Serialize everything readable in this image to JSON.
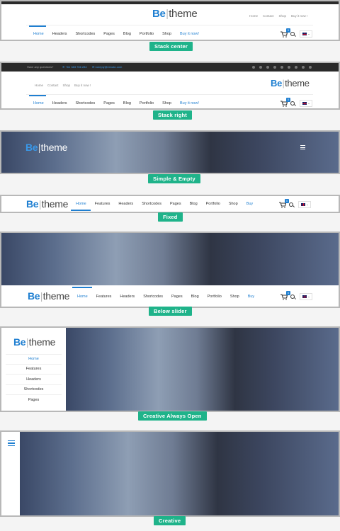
{
  "logo": {
    "be": "Be",
    "bar": "|",
    "theme": "theme"
  },
  "sections": [
    {
      "label": "Stack center"
    },
    {
      "label": "Stack right"
    },
    {
      "label": "Simple & Empty"
    },
    {
      "label": "Fixed"
    },
    {
      "label": "Below slider"
    },
    {
      "label": "Creative Always Open"
    },
    {
      "label": "Creative"
    }
  ],
  "top_links": [
    "Home",
    "Contact",
    "Shop",
    "Buy it now !"
  ],
  "main_menu": [
    "Home",
    "Headers",
    "Shortcodes",
    "Pages",
    "Blog",
    "Portfolio",
    "Shop",
    "Buy it now!"
  ],
  "wide_menu": [
    "Home",
    "Features",
    "Headers",
    "Shortcodes",
    "Pages",
    "Blog",
    "Portfolio",
    "Shop",
    "Buy"
  ],
  "topbar": {
    "question": "Have any questions?",
    "phone": "+61 383 766 284",
    "email": "noreply@envato.com"
  },
  "cart_count": "0",
  "creative_menu": [
    "Home",
    "Features",
    "Headers",
    "Shortcodes",
    "Pages"
  ],
  "colors": {
    "accent": "#1f7fd1",
    "label_bg": "#1fb38a",
    "frame_border": "#b8b8b8"
  },
  "icons": [
    "cart-icon",
    "search-icon",
    "uk-flag-icon",
    "menu-icon",
    "phone-icon",
    "mail-icon"
  ]
}
